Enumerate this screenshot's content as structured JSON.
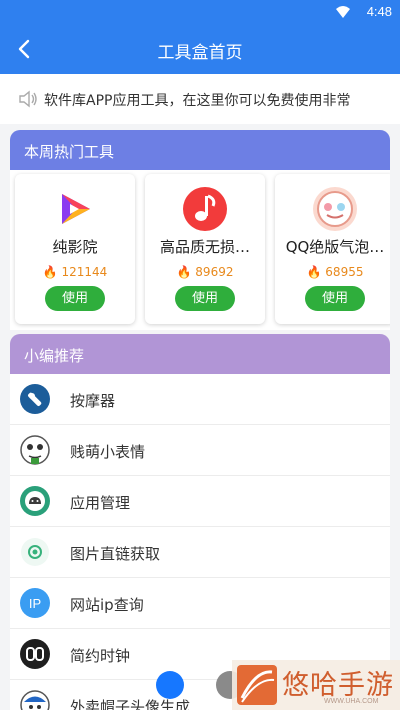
{
  "status_bar": {
    "time": "4:48",
    "wifi_icon": "wifi-icon"
  },
  "app_bar": {
    "title": "工具盒首页",
    "back_icon": "back-arrow-icon"
  },
  "marquee": {
    "icon": "speaker-icon",
    "text": "软件库APP应用工具，在这里你可以免费使用非常"
  },
  "hot_tools": {
    "header": "本周热门工具",
    "cards": [
      {
        "name": "纯影院",
        "count": "121144",
        "use_label": "使用",
        "icon": "play-icon"
      },
      {
        "name": "高品质无损…",
        "count": "89692",
        "use_label": "使用",
        "icon": "music-note-icon"
      },
      {
        "name": "QQ绝版气泡…",
        "count": "68955",
        "use_label": "使用",
        "icon": "bubble-icon"
      }
    ]
  },
  "recommend": {
    "header": "小编推荐",
    "items": [
      {
        "label": "按摩器",
        "icon": "massager-icon"
      },
      {
        "label": "贱萌小表情",
        "icon": "meme-face-icon"
      },
      {
        "label": "应用管理",
        "icon": "android-icon"
      },
      {
        "label": "图片直链获取",
        "icon": "image-link-icon"
      },
      {
        "label": "网站ip查询",
        "icon": "ip-icon"
      },
      {
        "label": "简约时钟",
        "icon": "clock-icon"
      },
      {
        "label": "外卖帽子头像生成",
        "icon": "hat-avatar-icon"
      }
    ]
  },
  "watermark": {
    "text": "悠哈手游",
    "url": "WWW.UHA.COM"
  },
  "colors": {
    "primary": "#2f80ef",
    "hot_header": "#6d7fe4",
    "rec_header": "#b195d6",
    "use_button": "#2fae3c",
    "count": "#e8891c"
  }
}
